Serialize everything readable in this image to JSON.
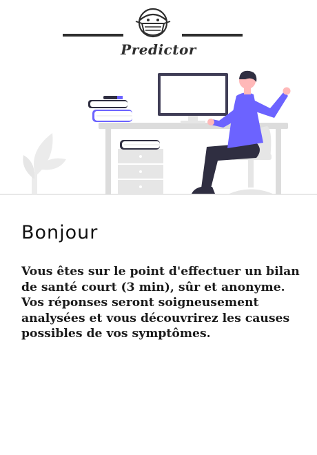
{
  "app": {
    "logo_text": "Predictor",
    "logo_icon": "masked-doctor-icon"
  },
  "illustration": {
    "icon": "person-at-desk-with-computer-illustration"
  },
  "content": {
    "greeting": "Bonjour",
    "intro": "Vous êtes sur le point d'effectuer un bilan de santé court (3 min), sûr et anonyme. Vos réponses seront soigneusement analysées et vous découvrirez les causes possibles de vos symptômes."
  },
  "colors": {
    "accent": "#6c63ff",
    "dark": "#2f2e41",
    "light_gray": "#e6e6e6",
    "skin": "#ffb8b8"
  }
}
